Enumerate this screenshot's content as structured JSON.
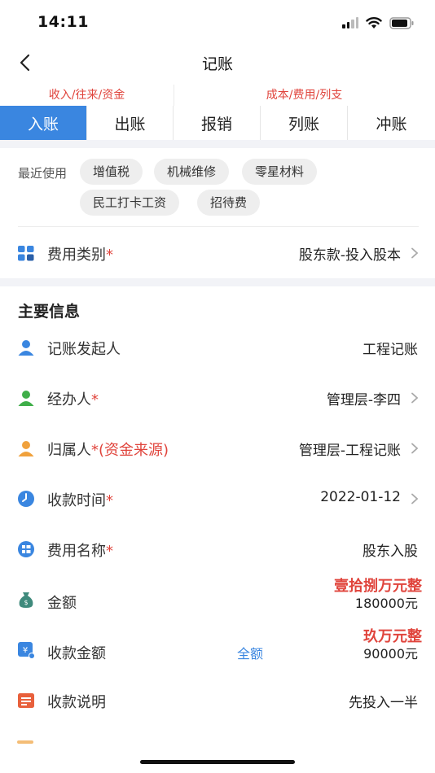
{
  "status": {
    "time": "14:11"
  },
  "nav": {
    "title": "记账"
  },
  "tab_groups": [
    {
      "label": "收入/往来/资金"
    },
    {
      "label": "成本/费用/列支"
    }
  ],
  "tabs": [
    {
      "label": "入账",
      "active": true
    },
    {
      "label": "出账",
      "active": false
    },
    {
      "label": "报销",
      "active": false
    },
    {
      "label": "列账",
      "active": false
    },
    {
      "label": "冲账",
      "active": false
    }
  ],
  "recent": {
    "label": "最近使用",
    "chips": [
      "增值税",
      "机械维修",
      "零星材料",
      "民工打卡工资",
      "招待费"
    ]
  },
  "category": {
    "label": "费用类别",
    "required": "*",
    "value": "股东款-投入股本"
  },
  "main_section": {
    "title": "主要信息"
  },
  "fields": {
    "initiator": {
      "label": "记账发起人",
      "value": "工程记账"
    },
    "handler": {
      "label": "经办人",
      "required": "*",
      "value": "管理层-李四"
    },
    "owner": {
      "label": "归属人",
      "required": "*(资金来源)",
      "value": "管理层-工程记账"
    },
    "receive_time": {
      "label": "收款时间",
      "required": "*",
      "value": "2022-01-12"
    },
    "fee_name": {
      "label": "费用名称",
      "required": "*",
      "value": "股东入股"
    },
    "amount": {
      "label": "金额",
      "value_cn": "壹拾捌万元整",
      "value": "180000元"
    },
    "received_amount": {
      "label": "收款金额",
      "full_label": "全额",
      "value_cn": "玖万元整",
      "value": "90000元"
    },
    "receive_note": {
      "label": "收款说明",
      "value": "先投入一半"
    }
  },
  "colors": {
    "accent": "#3a86e0",
    "required": "#e0443c",
    "icon_green": "#3fae49",
    "icon_orange": "#f0a13c",
    "icon_teal": "#3f8a7c",
    "icon_note": "#e8603c"
  },
  "icons": {
    "category": "grid-icon",
    "initiator": "person-icon",
    "handler": "person-icon",
    "owner": "person-icon",
    "receive_time": "clock-icon",
    "fee_name": "list-icon",
    "amount": "money-bag-icon",
    "received_amount": "yen-card-icon",
    "receive_note": "note-icon"
  }
}
